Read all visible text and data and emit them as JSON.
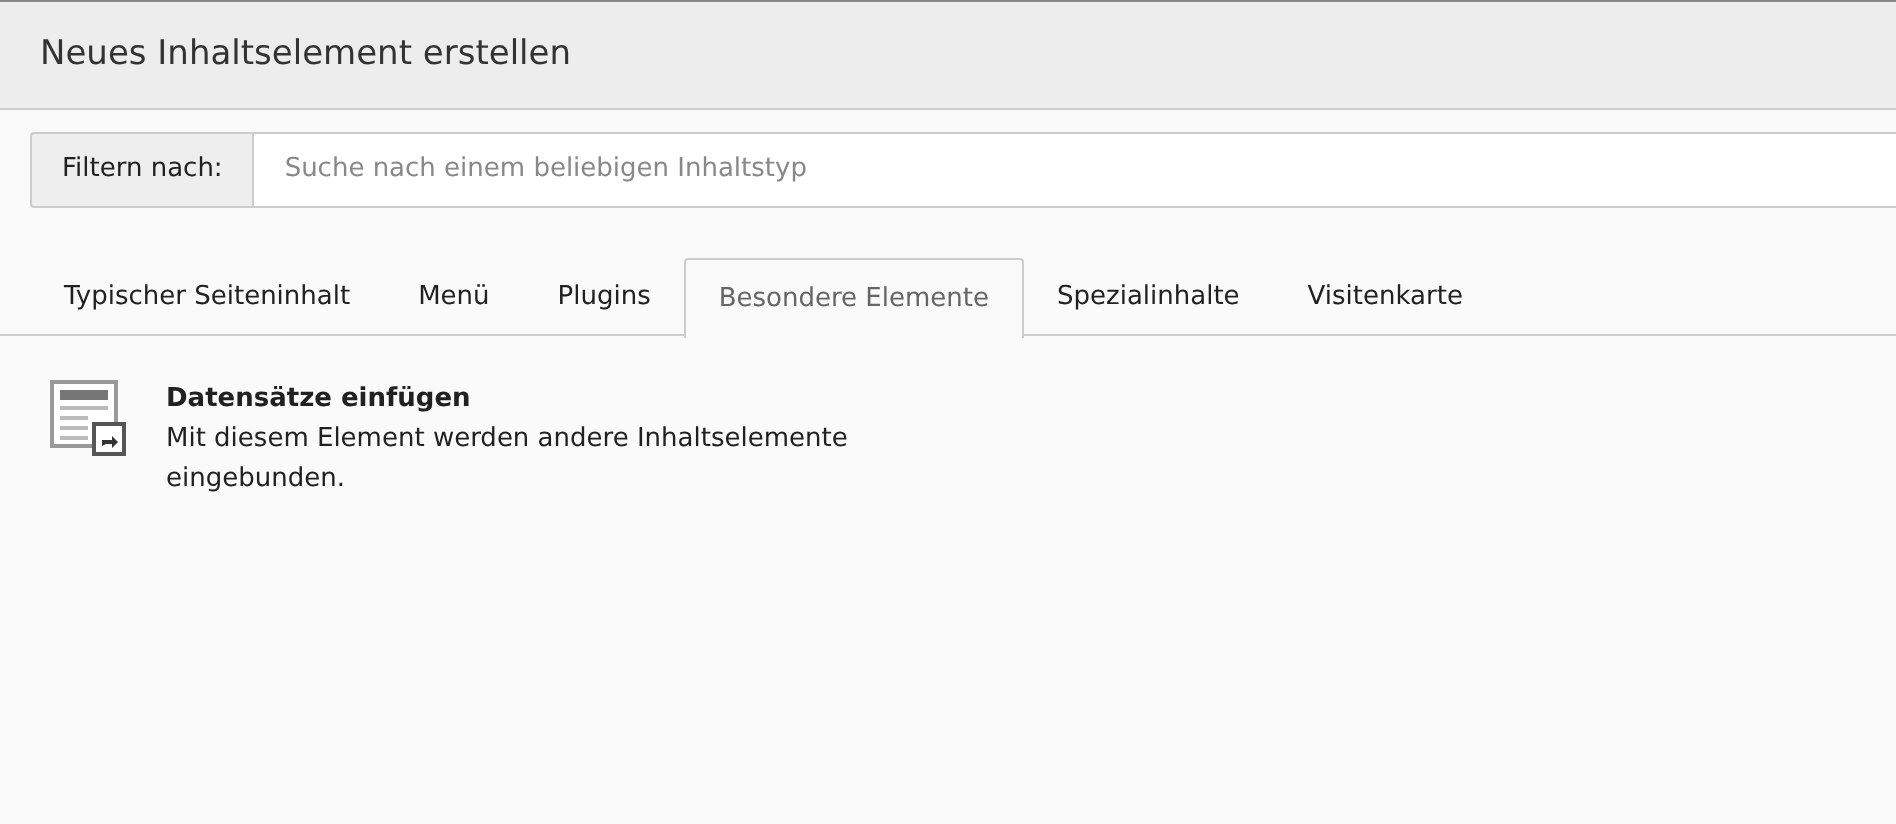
{
  "window": {
    "title": "Neues Inhaltselement erstellen"
  },
  "filter": {
    "label": "Filtern nach:",
    "placeholder": "Suche nach einem beliebigen Inhaltstyp"
  },
  "tabs": [
    {
      "label": "Typischer Seiteninhalt",
      "selected": false
    },
    {
      "label": "Menü",
      "selected": false
    },
    {
      "label": "Plugins",
      "selected": false
    },
    {
      "label": "Besondere Elemente",
      "selected": true
    },
    {
      "label": "Spezialinhalte",
      "selected": false
    },
    {
      "label": "Visitenkarte",
      "selected": false
    }
  ],
  "items": [
    {
      "title": "Datensätze einfügen",
      "description": "Mit diesem Element werden andere Inhaltselemente eingebunden."
    }
  ]
}
